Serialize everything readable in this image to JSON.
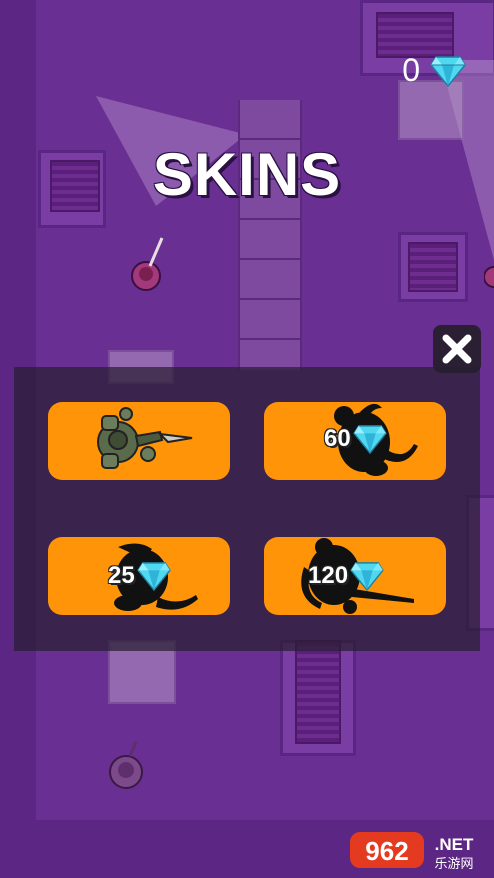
{
  "hud": {
    "gem_count": "0",
    "gem_icon": "diamond-icon"
  },
  "screen": {
    "title": "SKINS"
  },
  "close_button": {
    "icon": "close-icon"
  },
  "skins": [
    {
      "id": "soldier",
      "price": "",
      "owned": true
    },
    {
      "id": "rat",
      "price": "60",
      "owned": false
    },
    {
      "id": "lizard",
      "price": "25",
      "owned": false
    },
    {
      "id": "chainsaw",
      "price": "120",
      "owned": false
    }
  ],
  "watermark": {
    "brand": "962.NET",
    "sub": "乐游网"
  },
  "colors": {
    "background": "#6a2f93",
    "card": "#ff9408",
    "panel": "#281e32",
    "gem": "#4fd8f0"
  }
}
